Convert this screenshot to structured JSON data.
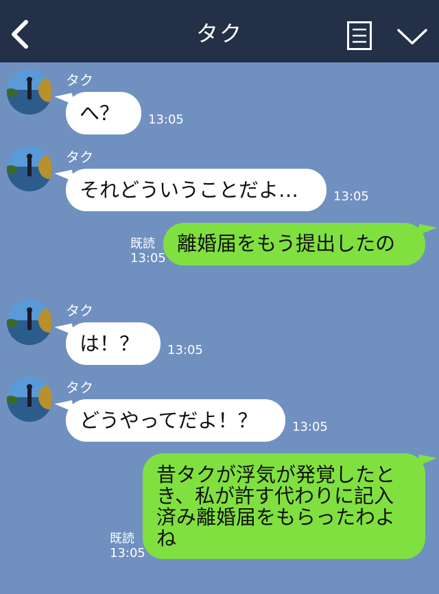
{
  "header": {
    "back_icon": "chevron-left-icon",
    "title": "タク",
    "menu_icon": "note-icon",
    "dropdown_icon": "chevron-down-icon"
  },
  "colors": {
    "header_bg": "#243048",
    "chat_bg": "#7090c0",
    "incoming_bubble": "#ffffff",
    "outgoing_bubble": "#80e040"
  },
  "messages": [
    {
      "direction": "in",
      "sender": "タク",
      "text": "へ？",
      "time": "13:05"
    },
    {
      "direction": "in",
      "sender": "タク",
      "text": "それどういうことだよ…",
      "time": "13:05"
    },
    {
      "direction": "out",
      "text": "離婚届をもう提出したの",
      "read": "既読",
      "time": "13:05"
    },
    {
      "direction": "in",
      "sender": "タク",
      "text": "は！？",
      "time": "13:05"
    },
    {
      "direction": "in",
      "sender": "タク",
      "text": "どうやってだよ！？",
      "time": "13:05"
    },
    {
      "direction": "out",
      "text": "昔タクが浮気が発覚したとき、私が許す代わりに記入済み離婚届をもらったわよね",
      "read": "既読",
      "time": "13:05"
    }
  ]
}
